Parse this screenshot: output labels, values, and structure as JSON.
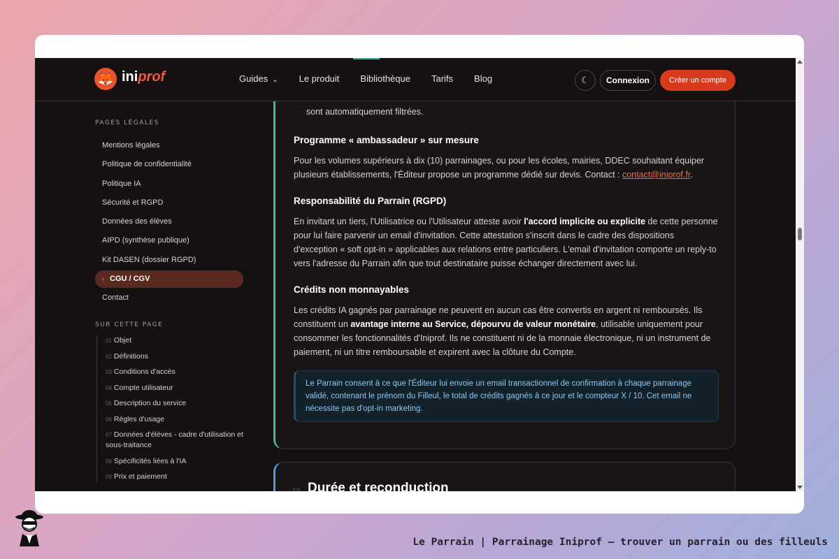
{
  "header": {
    "logo_ini": "ini",
    "logo_prof": "prof",
    "nav": [
      "Guides",
      "Le produit",
      "Bibliothèque",
      "Tarifs",
      "Blog"
    ],
    "login": "Connexion",
    "signup": "Créer un compte"
  },
  "sidebar": {
    "legal_heading": "PAGES LÉGALES",
    "legal_items": [
      "Mentions légales",
      "Politique de confidentialité",
      "Politique IA",
      "Sécurité et RGPD",
      "Données des élèves",
      "AIPD (synthèse publique)",
      "Kit DASEN (dossier RGPD)",
      "CGU / CGV",
      "Contact"
    ],
    "toc_heading": "SUR CETTE PAGE",
    "toc": [
      {
        "num": "01",
        "label": "Objet"
      },
      {
        "num": "02",
        "label": "Définitions"
      },
      {
        "num": "03",
        "label": "Conditions d'accès"
      },
      {
        "num": "04",
        "label": "Compte utilisateur"
      },
      {
        "num": "05",
        "label": "Description du service"
      },
      {
        "num": "06",
        "label": "Règles d'usage"
      },
      {
        "num": "07",
        "label": "Données d'élèves - cadre d'utilisation et sous-traitance"
      },
      {
        "num": "08",
        "label": "Spécificités liées à l'IA"
      },
      {
        "num": "09",
        "label": "Prix et paiement"
      }
    ]
  },
  "content": {
    "bullet_fragment": "sont automatiquement filtrées.",
    "s1_title": "Programme « ambassadeur » sur mesure",
    "s1_text": "Pour les volumes supérieurs à dix (10) parrainages, ou pour les écoles, mairies, DDEC souhaitant équiper plusieurs établissements, l'Éditeur propose un programme dédié sur devis. Contact : ",
    "s1_email": "contact@iniprof.fr",
    "s1_end": ".",
    "s2_title": "Responsabilité du Parrain (RGPD)",
    "s2_a": "En invitant un tiers, l'Utilisatrice ou l'Utilisateur atteste avoir ",
    "s2_b": "l'accord implicite ou explicite",
    "s2_c": " de cette personne pour lui faire parvenir un email d'invitation. Cette attestation s'inscrit dans le cadre des dispositions d'exception « soft opt-in » applicables aux relations entre particuliers. L'email d'invitation comporte un reply-to vers l'adresse du Parrain afin que tout destinataire puisse échanger directement avec lui.",
    "s3_title": "Crédits non monnayables",
    "s3_a": "Les crédits IA gagnés par parrainage ne peuvent en aucun cas être convertis en argent ni remboursés. Ils constituent un ",
    "s3_b": "avantage interne au Service, dépourvu de valeur monétaire",
    "s3_c": ", utilisable uniquement pour consommer les fonctionnalités d'Iniprof. Ils ne constituent ni de la monnaie électronique, ni un instrument de paiement, ni un titre remboursable et expirent avec la clôture du Compte.",
    "callout": "Le Parrain consent à ce que l'Éditeur lui envoie un email transactionnel de confirmation à chaque parrainage validé, contenant le prénom du Filleul, le total de crédits gagnés à ce jour et le compteur X / 10. Cet email ne nécessite pas d'opt-in marketing.",
    "next_num": "10",
    "next_title": "Durée et reconduction"
  },
  "caption": "Le Parrain | Parrainage Iniprof — trouver un parrain ou des filleuls",
  "colors": {
    "accent": "#d83a1e",
    "brand": "#ef5a3c",
    "callout_text": "#8fc7ee",
    "green_border": "#3fbf8c"
  }
}
